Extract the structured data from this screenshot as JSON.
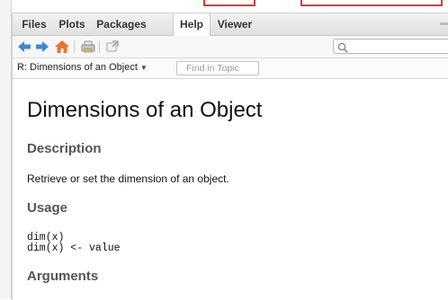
{
  "tabs": [
    {
      "label": "Files",
      "active": false
    },
    {
      "label": "Plots",
      "active": false
    },
    {
      "label": "Packages",
      "active": false
    },
    {
      "label": "Help",
      "active": true
    },
    {
      "label": "Viewer",
      "active": false
    }
  ],
  "toolbar": {
    "icons": [
      "back-arrow-icon",
      "forward-arrow-icon",
      "home-icon",
      "print-icon",
      "new-window-icon"
    ],
    "search": {
      "value": "",
      "placeholder": ""
    }
  },
  "topic_bar": {
    "topic": "R: Dimensions of an Object",
    "find_placeholder": "Find in Topic"
  },
  "doc": {
    "title": "Dimensions of an Object",
    "sections": {
      "description": {
        "heading": "Description",
        "text": "Retrieve or set the dimension of an object."
      },
      "usage": {
        "heading": "Usage",
        "code": [
          "dim(x)",
          "dim(x) <- value"
        ]
      },
      "arguments": {
        "heading": "Arguments"
      }
    }
  },
  "colors": {
    "accent_red": "#d63b3b",
    "nav_blue": "#3f86d1",
    "home_orange": "#e8762c",
    "heading_gray": "#555555"
  }
}
